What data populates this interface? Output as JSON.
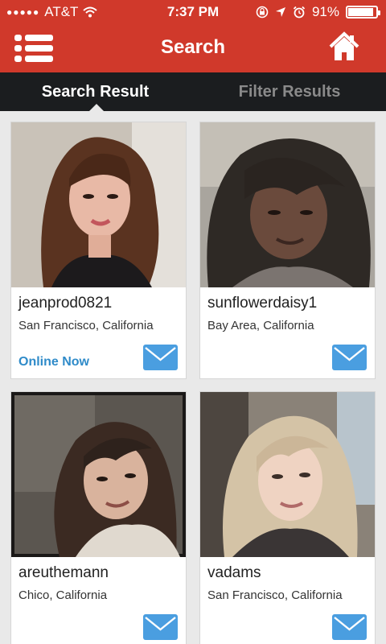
{
  "status_bar": {
    "carrier": "AT&T",
    "time": "7:37 PM",
    "battery": "91%",
    "battery_level": 0.91,
    "icons": [
      "signal-dots-icon",
      "wifi-icon",
      "rotation-lock-icon",
      "location-arrow-icon",
      "alarm-icon",
      "battery-icon"
    ]
  },
  "nav": {
    "title": "Search",
    "menu_icon": "list-menu-icon",
    "home_icon": "home-icon"
  },
  "tabs": [
    {
      "label": "Search Result",
      "active": true
    },
    {
      "label": "Filter Results",
      "active": false
    }
  ],
  "results": [
    {
      "username": "jeanprod0821",
      "location": "San Francisco, California",
      "status": "Online Now"
    },
    {
      "username": "sunflowerdaisy1",
      "location": "Bay Area, California"
    },
    {
      "username": "areuthemann",
      "location": "Chico, California"
    },
    {
      "username": "vadams",
      "location": "San Francisco, California"
    }
  ],
  "colors": {
    "header_red": "#d0392b",
    "tab_bar": "#1b1d1f",
    "online_blue": "#2f8bc9",
    "mail_blue": "#4a9ee0"
  }
}
